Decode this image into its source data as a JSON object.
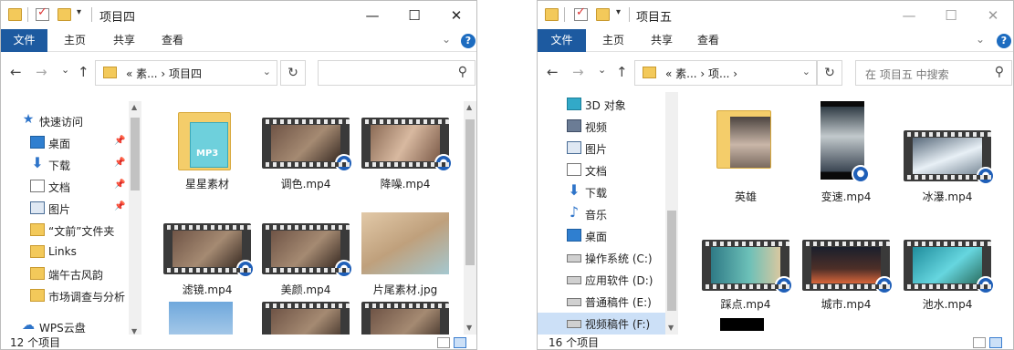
{
  "w1": {
    "title": "项目四",
    "ribbon": [
      "文件",
      "主页",
      "共享",
      "查看"
    ],
    "address": "«  素...  ›  项目四",
    "nav": [
      {
        "label": "快速访问",
        "icon": "star-icon",
        "pin": false
      },
      {
        "label": "桌面",
        "icon": "desktop-icon",
        "pin": true
      },
      {
        "label": "下载",
        "icon": "download-icon",
        "pin": true
      },
      {
        "label": "文档",
        "icon": "document-icon",
        "pin": true
      },
      {
        "label": "图片",
        "icon": "picture-icon",
        "pin": true
      },
      {
        "label": "“文前”文件夹",
        "icon": "folder-icon",
        "pin": false
      },
      {
        "label": "Links",
        "icon": "folder-icon",
        "pin": false
      },
      {
        "label": "端午古风韵",
        "icon": "folder-icon",
        "pin": false
      },
      {
        "label": "市场调查与分析",
        "icon": "folder-icon",
        "pin": false
      },
      {
        "label": "WPS云盘",
        "icon": "cloud-icon",
        "pin": false
      }
    ],
    "files": [
      "星星素材",
      "调色.mp4",
      "降噪.mp4",
      "滤镜.mp4",
      "美颜.mp4",
      "片尾素材.jpg",
      "",
      "",
      ""
    ],
    "status": "12 个项目"
  },
  "w2": {
    "title": "项目五",
    "ribbon": [
      "文件",
      "主页",
      "共享",
      "查看"
    ],
    "address": "«  素...  ›  项...  ›",
    "search_placeholder": "在 项目五 中搜索",
    "nav": [
      {
        "label": "3D 对象",
        "icon": "3d-objects-icon"
      },
      {
        "label": "视频",
        "icon": "video-icon"
      },
      {
        "label": "图片",
        "icon": "picture-icon"
      },
      {
        "label": "文档",
        "icon": "document-icon"
      },
      {
        "label": "下载",
        "icon": "download-icon"
      },
      {
        "label": "音乐",
        "icon": "music-icon"
      },
      {
        "label": "桌面",
        "icon": "desktop-icon"
      },
      {
        "label": "操作系统 (C:)",
        "icon": "drive-icon"
      },
      {
        "label": "应用软件 (D:)",
        "icon": "drive-icon"
      },
      {
        "label": "普通稿件 (E:)",
        "icon": "drive-icon"
      },
      {
        "label": "视频稿件 (F:)",
        "icon": "drive-icon"
      }
    ],
    "files": [
      "英雄",
      "变速.mp4",
      "冰瀑.mp4",
      "踩点.mp4",
      "城市.mp4",
      "池水.mp4"
    ],
    "status": "16 个项目"
  },
  "glyphs": {
    "back": "←",
    "fwd": "→",
    "recent": "⌄",
    "up": "↑",
    "refresh": "↻",
    "search": "⚲",
    "min": "—",
    "max": "☐",
    "close": "✕",
    "pin": "📌"
  }
}
